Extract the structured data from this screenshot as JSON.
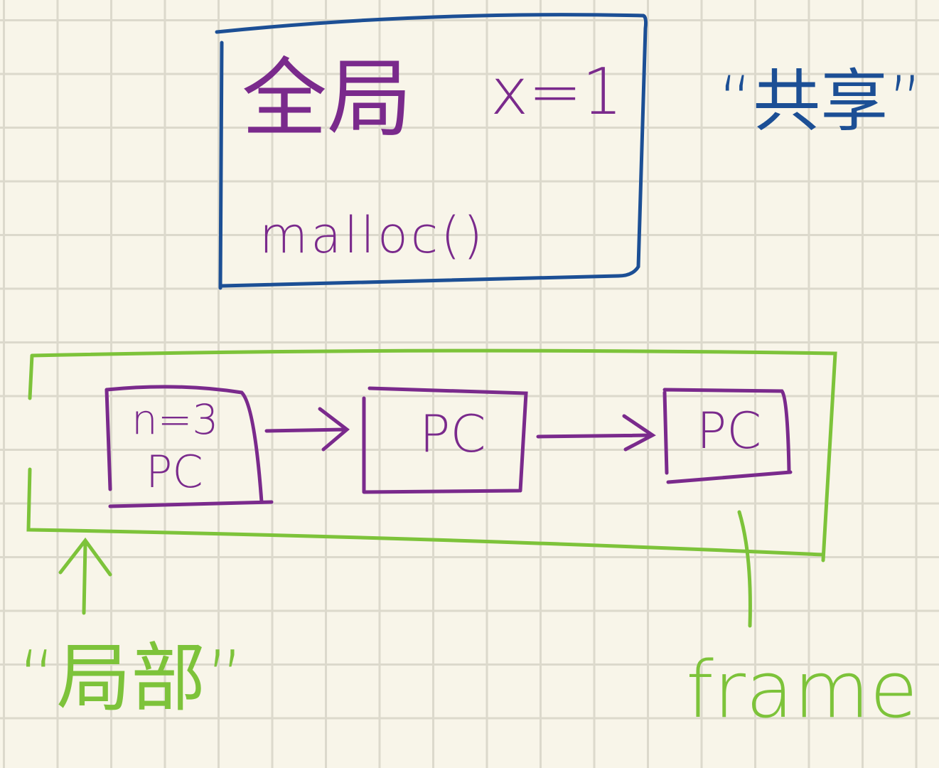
{
  "global_box": {
    "title": "全局",
    "var": "x=1",
    "call": "malloc()"
  },
  "shared_label": "“共享”",
  "stack": {
    "frames": [
      {
        "lines": [
          "n=3",
          "PC"
        ]
      },
      {
        "lines": [
          "PC"
        ]
      },
      {
        "lines": [
          "PC"
        ]
      }
    ]
  },
  "local_label": "“局部”",
  "frame_label": "frame",
  "colors": {
    "blue": "#1c4f95",
    "purple": "#7a2a8c",
    "green": "#7dc33a",
    "paper": "#f8f5e9",
    "grid": "#dcd9cc"
  }
}
